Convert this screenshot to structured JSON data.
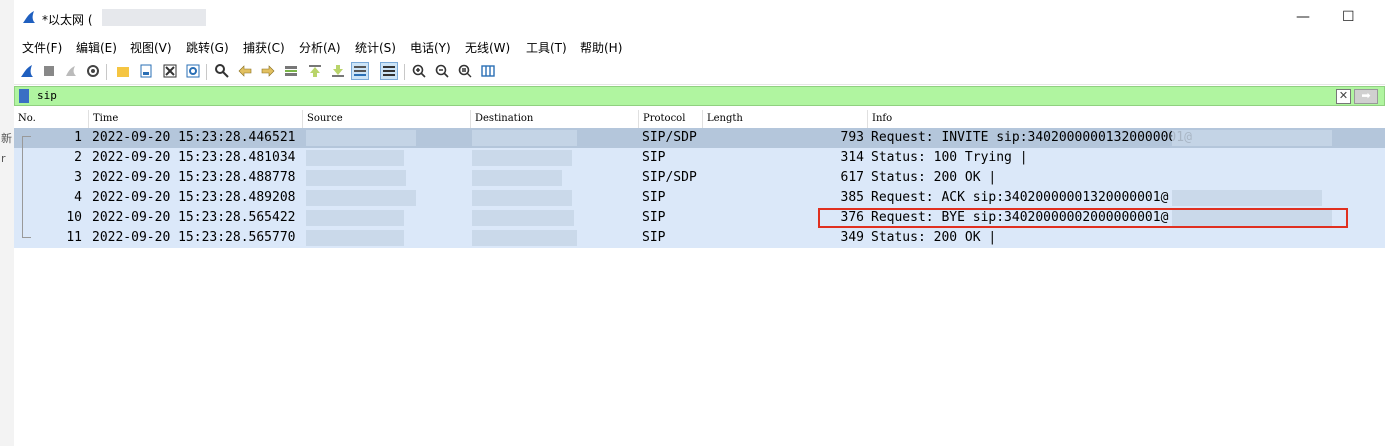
{
  "window": {
    "title": "*以太网 (",
    "minimize_glyph": "—",
    "maximize_glyph": "☐"
  },
  "side_fragments": [
    "新",
    "r"
  ],
  "menu": [
    {
      "label": "文件(F)",
      "name": "menu-file"
    },
    {
      "label": "编辑(E)",
      "name": "menu-edit"
    },
    {
      "label": "视图(V)",
      "name": "menu-view"
    },
    {
      "label": "跳转(G)",
      "name": "menu-go"
    },
    {
      "label": "捕获(C)",
      "name": "menu-capture"
    },
    {
      "label": "分析(A)",
      "name": "menu-analyze"
    },
    {
      "label": "统计(S)",
      "name": "menu-statistics"
    },
    {
      "label": "电话(Y)",
      "name": "menu-telephony"
    },
    {
      "label": "无线(W)",
      "name": "menu-wireless"
    },
    {
      "label": "工具(T)",
      "name": "menu-tools"
    },
    {
      "label": "帮助(H)",
      "name": "menu-help"
    }
  ],
  "toolbar_icons": [
    "shark-fin-icon",
    "stop-icon",
    "restart-icon",
    "options-gear-icon",
    "open-folder-icon",
    "save-file-icon",
    "close-file-icon",
    "reload-icon",
    "find-icon",
    "back-arrow-icon",
    "forward-arrow-icon",
    "go-to-packet-icon",
    "first-packet-icon",
    "last-packet-icon",
    "autoscroll-icon",
    "colorize-icon",
    "zoom-in-icon",
    "zoom-out-icon",
    "zoom-normal-icon",
    "resize-columns-icon"
  ],
  "filter": {
    "value": "sip",
    "clear_glyph": "✕",
    "apply_glyph": "➡"
  },
  "columns": {
    "no": "No.",
    "time": "Time",
    "source": "Source",
    "destination": "Destination",
    "protocol": "Protocol",
    "length": "Length",
    "info": "Info"
  },
  "packets": [
    {
      "no": "1",
      "time": "2022-09-20 15:23:28.446521",
      "protocol": "SIP/SDP",
      "length": "793",
      "info": "Request: INVITE sip:34020000001320000001@"
    },
    {
      "no": "2",
      "time": "2022-09-20 15:23:28.481034",
      "protocol": "SIP",
      "length": "314",
      "info": "Status: 100 Trying |"
    },
    {
      "no": "3",
      "time": "2022-09-20 15:23:28.488778",
      "protocol": "SIP/SDP",
      "length": "617",
      "info": "Status: 200 OK |"
    },
    {
      "no": "4",
      "time": "2022-09-20 15:23:28.489208",
      "protocol": "SIP",
      "length": "385",
      "info": "Request: ACK sip:34020000001320000001@"
    },
    {
      "no": "10",
      "time": "2022-09-20 15:23:28.565422",
      "protocol": "SIP",
      "length": "376",
      "info": "Request: BYE sip:34020000002000000001@"
    },
    {
      "no": "11",
      "time": "2022-09-20 15:23:28.565770",
      "protocol": "SIP",
      "length": "349",
      "info": "Status: 200 OK |"
    }
  ],
  "colors": {
    "row_bg": "#dbe8f9",
    "selected_bg": "#b4c6db",
    "filter_bg": "#b0f5a0",
    "highlight": "#e03020"
  }
}
